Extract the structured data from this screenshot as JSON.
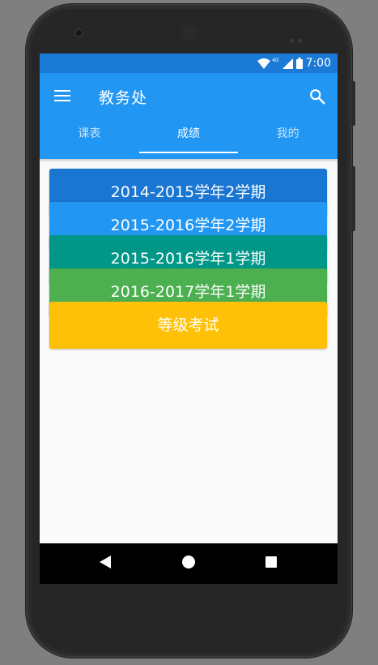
{
  "status_bar": {
    "time": "7:00",
    "network": "4G",
    "bar_color": "#1b7ad6"
  },
  "app_bar": {
    "title": "教务处",
    "menu_icon": "hamburger-menu-icon",
    "search_icon": "search-icon",
    "color": "#2196f3"
  },
  "tabs": [
    {
      "label": "课表",
      "active": false
    },
    {
      "label": "成绩",
      "active": true
    },
    {
      "label": "我的",
      "active": false
    }
  ],
  "cards": [
    {
      "label": "2014-2015学年2学期",
      "color": "#1976d2"
    },
    {
      "label": "2015-2016学年2学期",
      "color": "#2196f3"
    },
    {
      "label": "2015-2016学年1学期",
      "color": "#009688"
    },
    {
      "label": "2016-2017学年1学期",
      "color": "#4caf50"
    },
    {
      "label": "等级考试",
      "color": "#ffc107"
    }
  ],
  "nav_bar": {
    "back_icon": "back-triangle-icon",
    "home_icon": "home-circle-icon",
    "recents_icon": "recents-square-icon"
  }
}
